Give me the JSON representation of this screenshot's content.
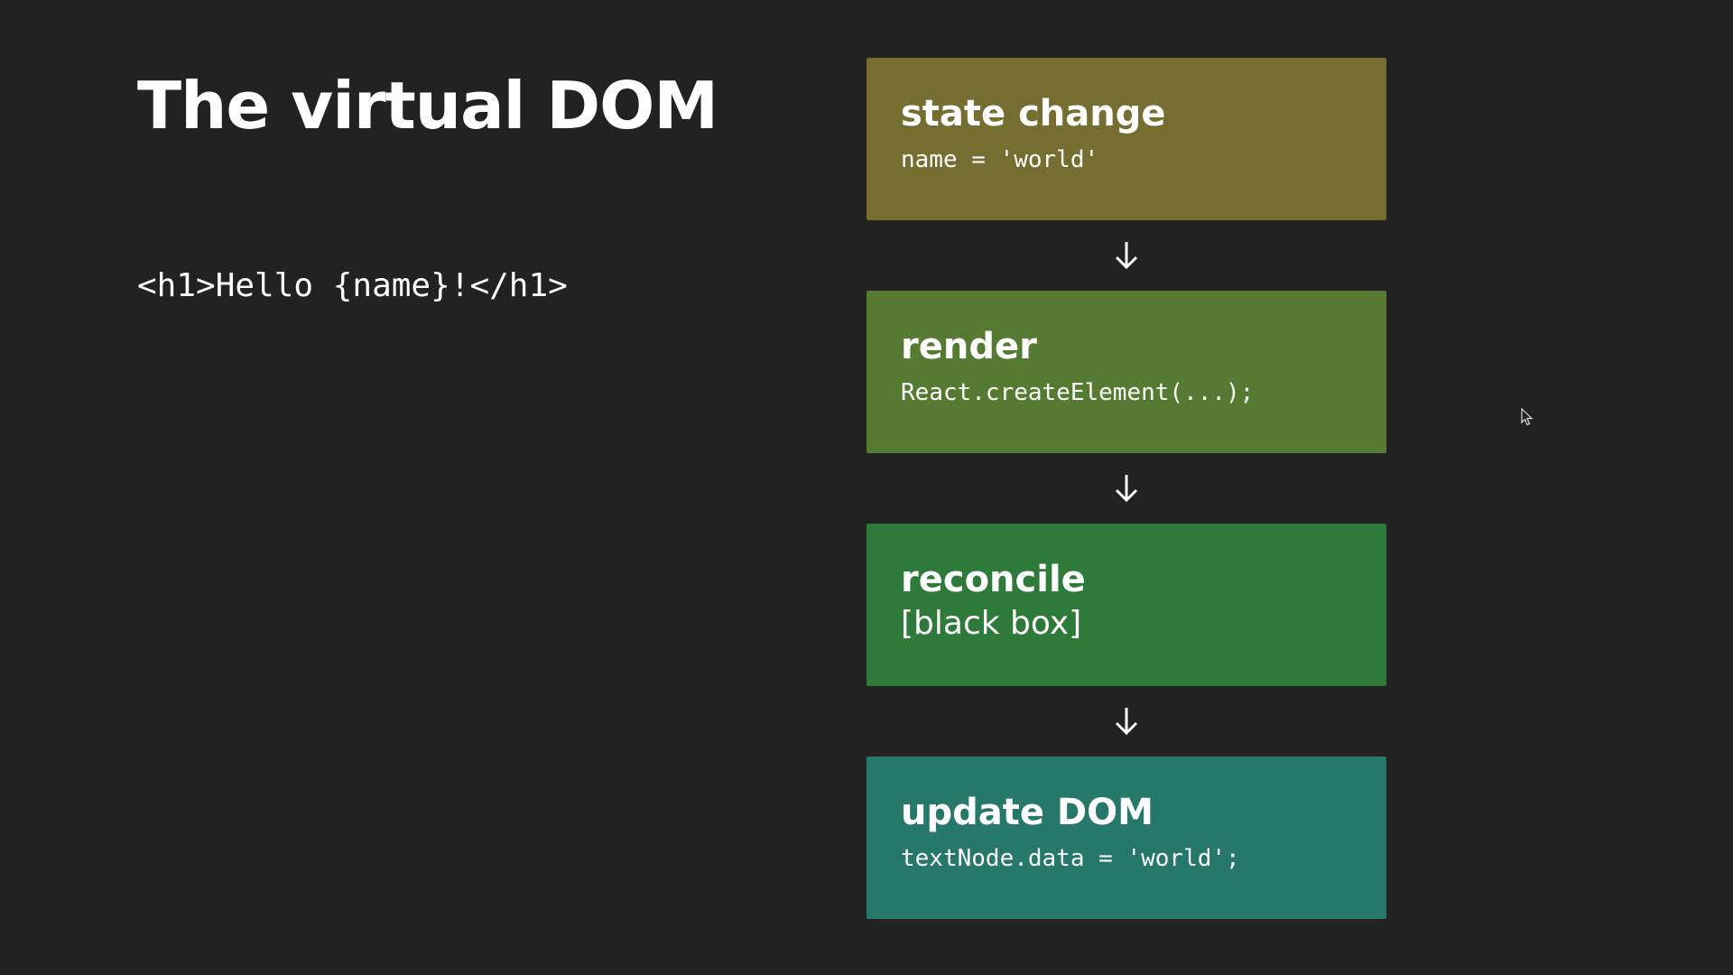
{
  "slide": {
    "title": "The virtual DOM",
    "code_snippet": "<h1>Hello {name}!</h1>"
  },
  "flow": {
    "steps": [
      {
        "title": "state change",
        "detail": "name = 'world'",
        "color": "#766d31"
      },
      {
        "title": "render",
        "detail": "React.createElement(...);",
        "color": "#557a31"
      },
      {
        "title": "reconcile",
        "detail": "[black box]",
        "color": "#2e7a3a"
      },
      {
        "title": "update DOM",
        "detail": "textNode.data = 'world';",
        "color": "#26786a"
      }
    ],
    "arrow_icon": "arrow-down-icon"
  },
  "colors": {
    "background": "#222222",
    "text": "#ffffff"
  }
}
